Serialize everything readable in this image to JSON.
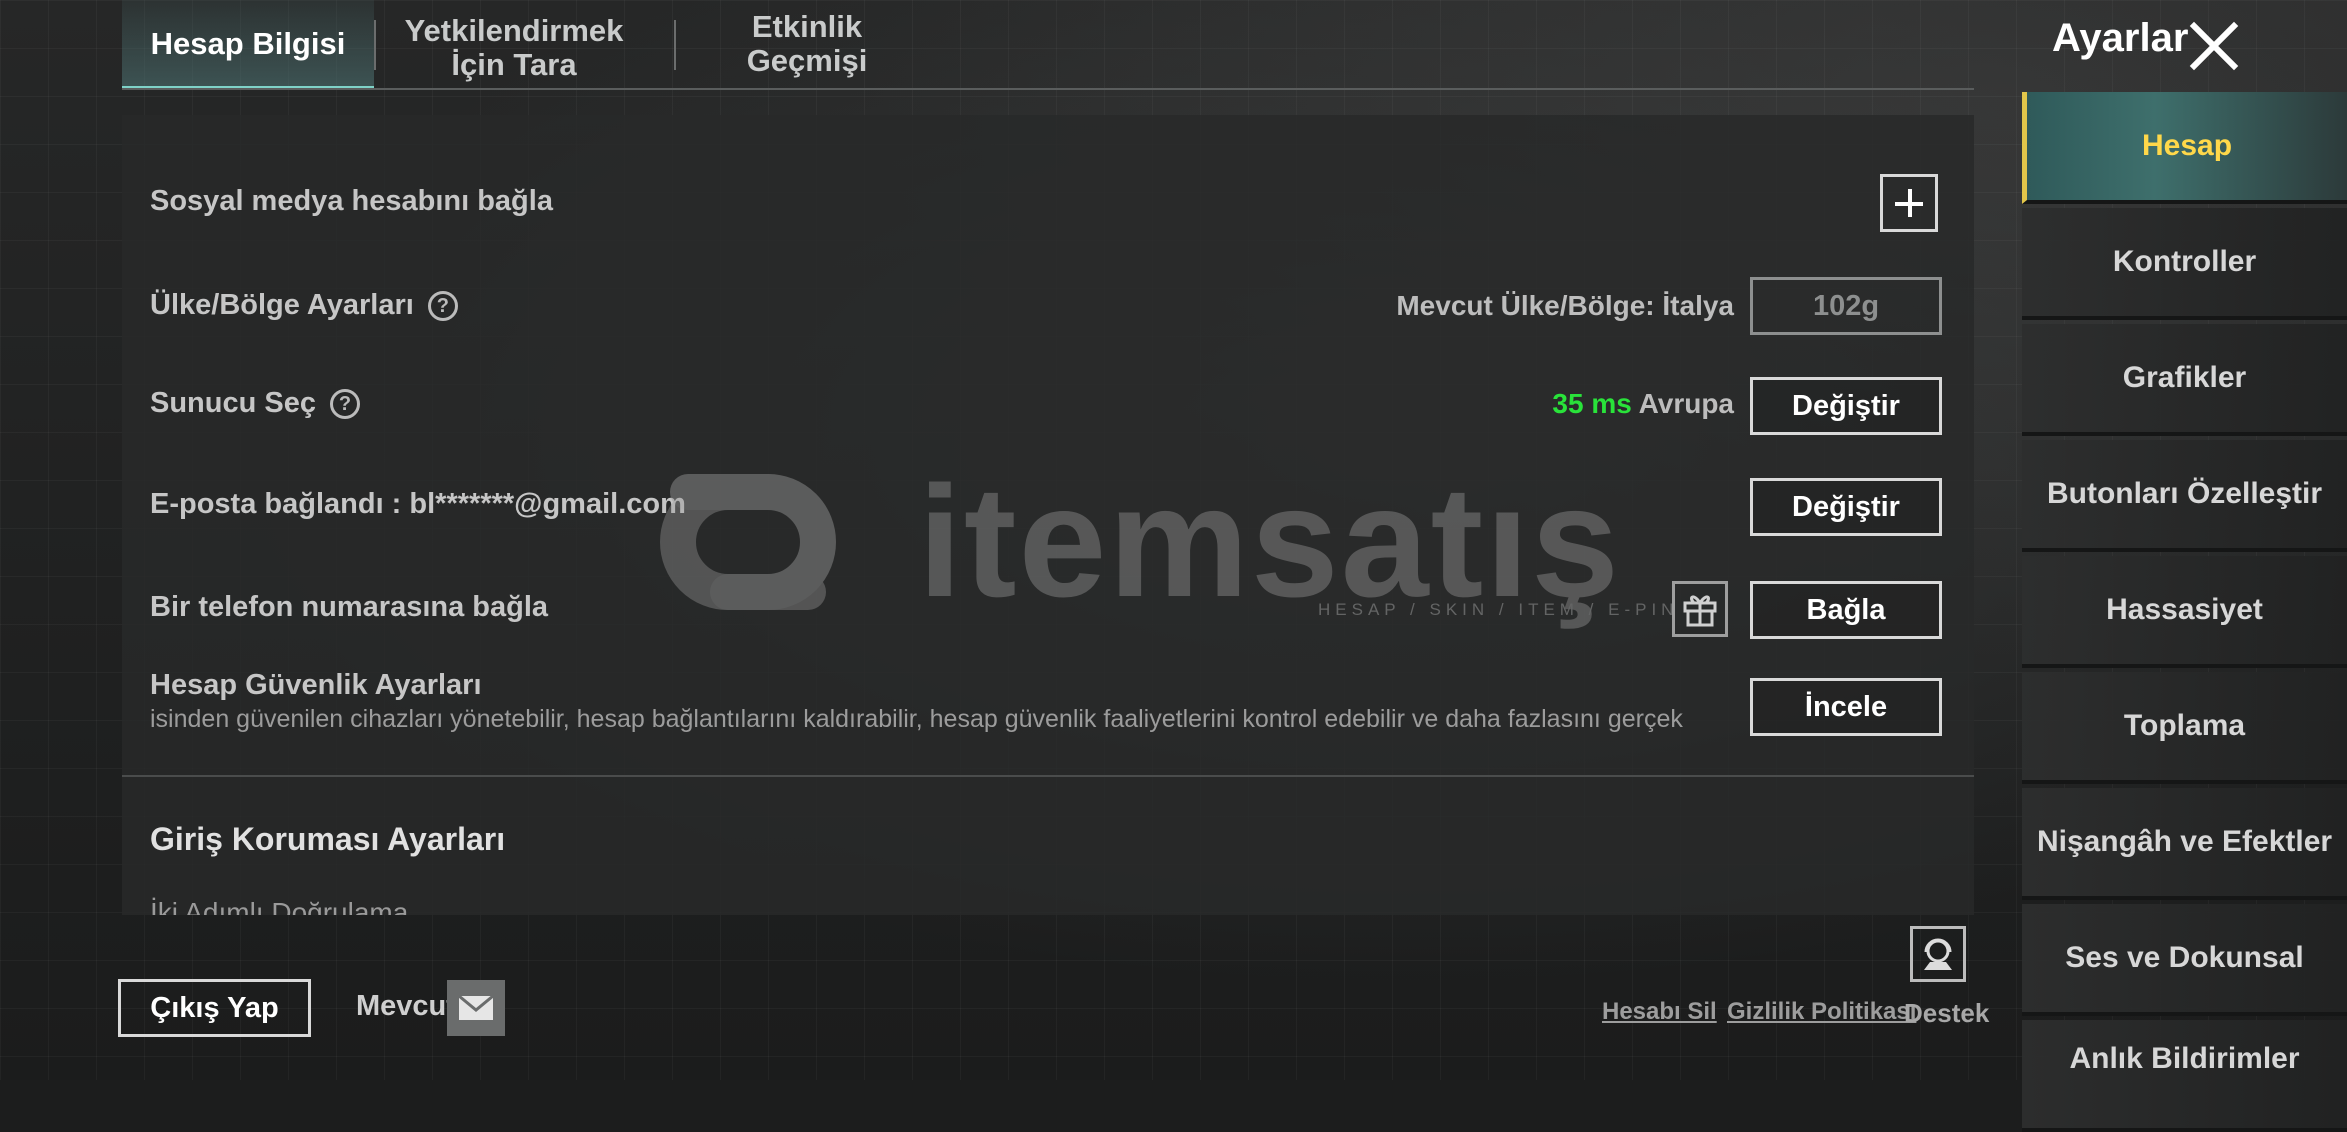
{
  "tabs": [
    {
      "label": "Hesap Bilgisi",
      "active": true
    },
    {
      "label": "Yetkilendirmek İçin Tara"
    },
    {
      "label": "Etkinlik Geçmişi"
    }
  ],
  "header": {
    "title": "Ayarlar",
    "close_icon": "close-icon"
  },
  "account": {
    "social_label": "Sosyal medya hesabını bağla",
    "region_label": "Ülke/Bölge Ayarları",
    "region_current": "Mevcut Ülke/Bölge: İtalya",
    "region_button": "102g",
    "server_label": "Sunucu Seç",
    "server_ping": "35 ms",
    "server_region": "Avrupa",
    "server_button": "Değiştir",
    "email_label": "E-posta bağlandı : bl*******@gmail.com",
    "email_button": "Değiştir",
    "phone_label": "Bir telefon numarasına bağla",
    "phone_button": "Bağla",
    "security_label": "Hesap Güvenlik Ayarları",
    "security_desc": "isinden güvenilen cihazları yönetebilir, hesap bağlantılarını kaldırabilir, hesap güvenlik faaliyetlerini kontrol edebilir ve daha fazlasını gerçek",
    "security_button": "İncele",
    "login_protection_title": "Giriş Koruması Ayarları",
    "cut_row": "İki Adımlı Doğrulama"
  },
  "watermark": {
    "text": "itemsatış",
    "subtitle": "HESAP / SKIN / ITEM / E-PIN"
  },
  "sidebar": {
    "items": [
      {
        "label": "Hesap",
        "active": true
      },
      {
        "label": "Kontroller"
      },
      {
        "label": "Grafikler"
      },
      {
        "label": "Butonları Özelleştir"
      },
      {
        "label": "Hassasiyet"
      },
      {
        "label": "Toplama"
      },
      {
        "label": "Nişangâh ve Efektler"
      },
      {
        "label": "Ses ve Dokunsal"
      },
      {
        "label": "Anlık Bildirimler"
      }
    ]
  },
  "footer": {
    "logout": "Çıkış Yap",
    "current": "Mevcut",
    "delete_account": "Hesabı Sil",
    "privacy": "Gizlilik Politikası",
    "support": "Destek"
  },
  "colors": {
    "accent": "#ffd84a",
    "ping_green": "#29e33a",
    "tab_active": "#7fd2c8"
  }
}
